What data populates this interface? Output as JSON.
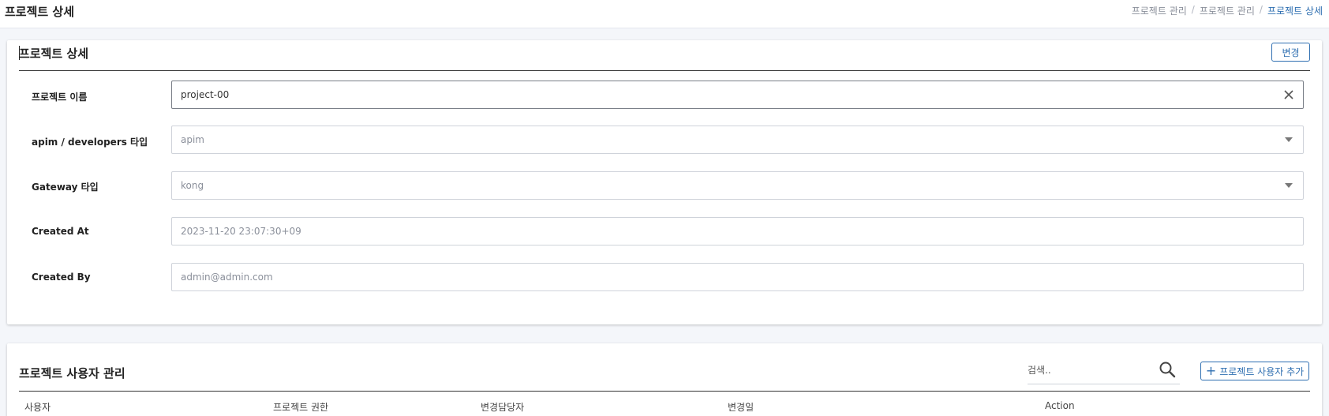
{
  "header": {
    "title": "프로젝트 상세",
    "breadcrumb": [
      "프로젝트 관리",
      "프로젝트 관리",
      "프로젝트 상세"
    ],
    "breadcrumb_separator": "/"
  },
  "detail": {
    "title": "프로젝트 상세",
    "change_button": "변경",
    "fields": [
      {
        "label": "프로젝트 이름",
        "value": "project-00",
        "icon": "close-icon"
      },
      {
        "label": "apim / developers 타입",
        "value": "apim",
        "icon": "caret-down-icon"
      },
      {
        "label": "Gateway 타입",
        "value": "kong",
        "icon": "caret-down-icon"
      },
      {
        "label": "Created At",
        "value": "2023-11-20 23:07:30+09"
      },
      {
        "label": "Created By",
        "value": "admin@admin.com"
      }
    ]
  },
  "users": {
    "title": "프로젝트 사용자 관리",
    "search_placeholder": "검색..",
    "add_button": "프로젝트 사용자 추가",
    "columns": [
      "사용자",
      "프로젝트 권한",
      "변경담당자",
      "변경일",
      "Action"
    ]
  },
  "colors": {
    "accent": "#2f6fb1",
    "background": "#f4f6fa"
  }
}
